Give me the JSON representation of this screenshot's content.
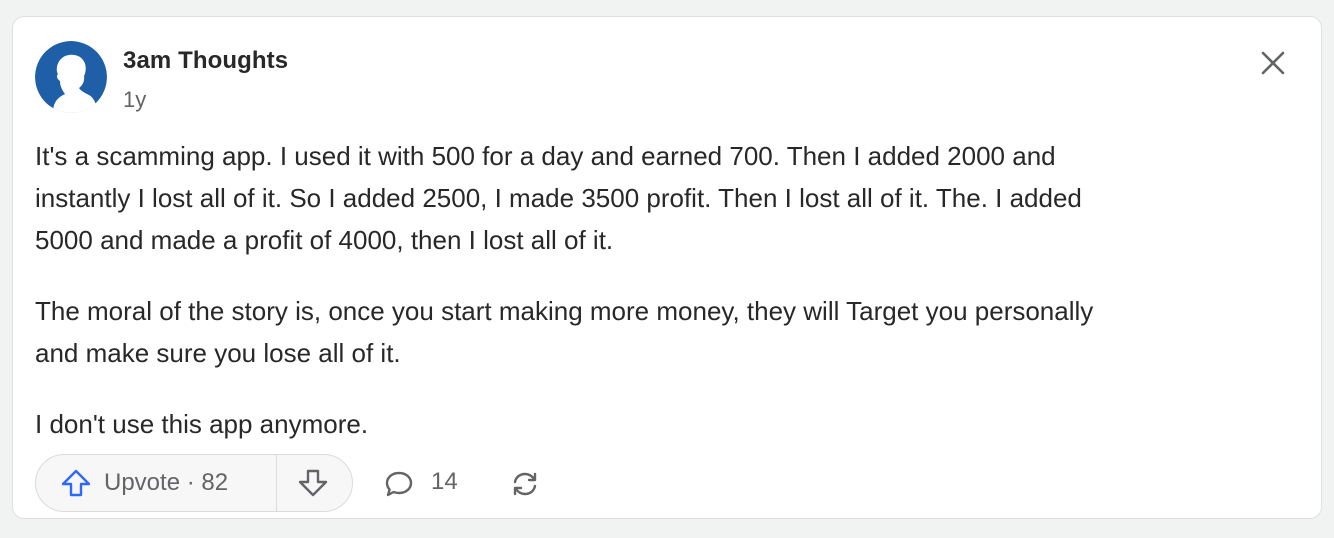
{
  "post": {
    "author": "3am Thoughts",
    "timestamp": "1y",
    "paragraphs": [
      "It's a scamming app. I used it with 500 for a day and earned 700. Then I added 2000 and",
      "instantly I lost all of it. So I added 2500, I made 3500 profit. Then I lost all of it. The. I added",
      "5000 and made a profit of 4000, then I lost all of it.",
      "The moral of the story is, once you start making more money, they will Target you personally",
      "and make sure you lose all of it.",
      "I don't use this app anymore."
    ]
  },
  "actions": {
    "upvote_label": "Upvote · 82",
    "comment_count": "14"
  },
  "icons": {
    "avatar": "user-avatar-silhouette",
    "close": "close-icon",
    "upvote": "arrow-up-icon",
    "downvote": "arrow-down-icon",
    "comment": "comment-bubble-icon",
    "share": "share-cycle-icon"
  },
  "colors": {
    "accent": "#2e69ff",
    "avatar_bg": "#1f5fa8",
    "text": "#282829",
    "muted": "#636466"
  }
}
